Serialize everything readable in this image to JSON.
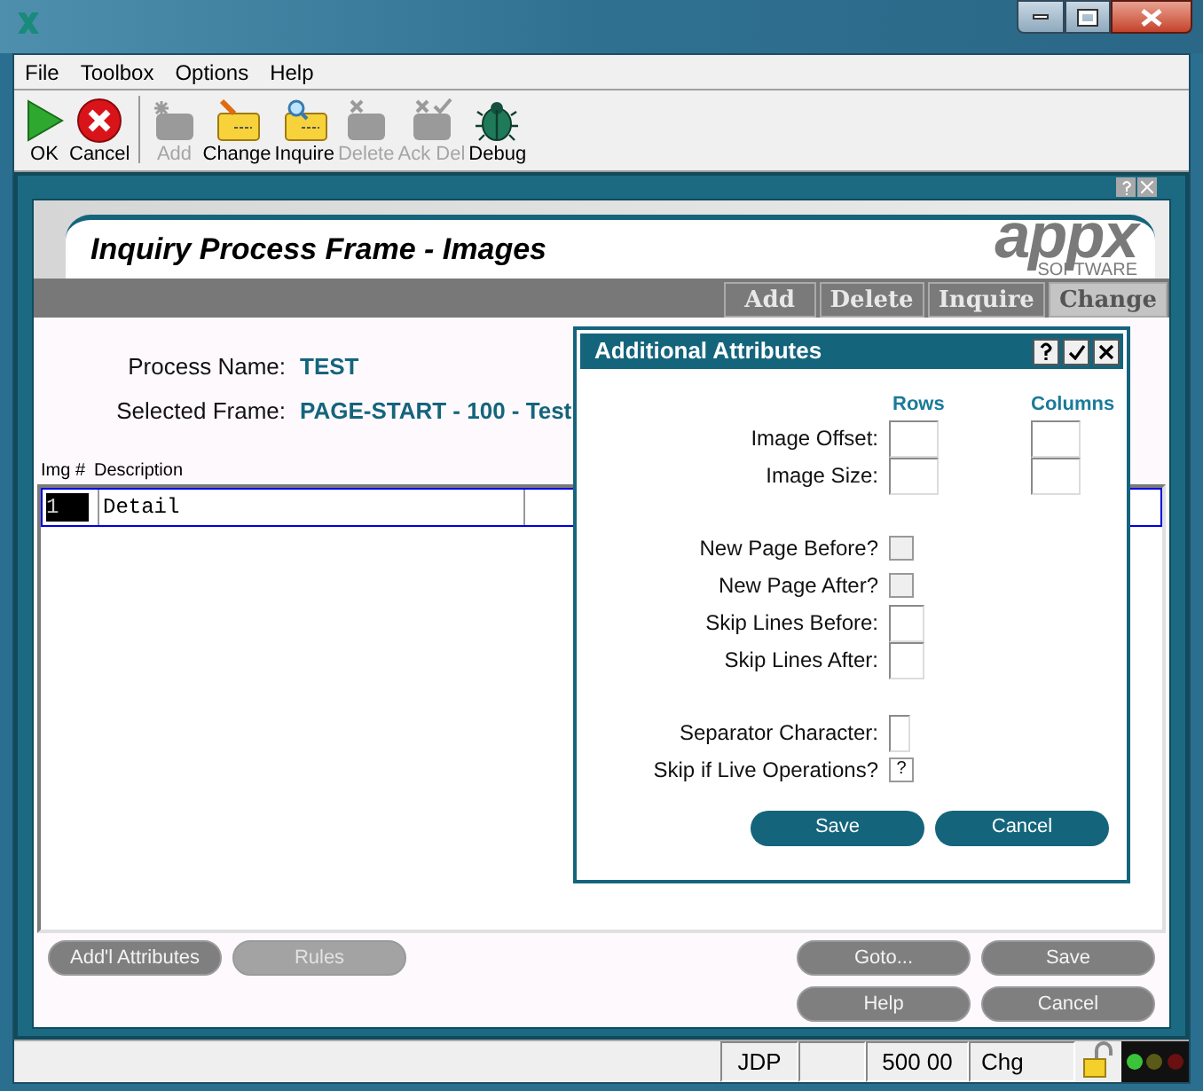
{
  "menu": [
    "File",
    "Toolbox",
    "Options",
    "Help"
  ],
  "toolbar": [
    {
      "label": "OK",
      "kind": "ok",
      "disabled": false
    },
    {
      "label": "Cancel",
      "kind": "cancel",
      "disabled": false
    },
    {
      "label": "Add",
      "kind": "add",
      "disabled": true
    },
    {
      "label": "Change",
      "kind": "change",
      "disabled": false
    },
    {
      "label": "Inquire",
      "kind": "inquire",
      "disabled": false
    },
    {
      "label": "Delete",
      "kind": "delete",
      "disabled": true
    },
    {
      "label": "Ack Del",
      "kind": "ackdel",
      "disabled": true
    },
    {
      "label": "Debug",
      "kind": "debug",
      "disabled": false
    }
  ],
  "frame": {
    "title": "Inquiry Process Frame - Images",
    "logo": {
      "word": "appx",
      "sub": "SOFTWARE"
    },
    "mode_tabs": [
      {
        "label": "Add",
        "selected": false
      },
      {
        "label": "Delete",
        "selected": false
      },
      {
        "label": "Inquire",
        "selected": false
      },
      {
        "label": "Change",
        "selected": true
      }
    ],
    "fields": [
      {
        "label": "Process Name:",
        "value": "TEST"
      },
      {
        "label": "Selected Frame:",
        "value": "PAGE-START - 100 - Test"
      }
    ],
    "table": {
      "columns": [
        "Img #",
        "Description"
      ],
      "rows": [
        {
          "img": "1",
          "description": "Detail",
          "selected": true
        }
      ]
    },
    "buttons_left": [
      {
        "label": "Add'l Attributes",
        "disabled": false
      },
      {
        "label": "Rules",
        "disabled": true
      }
    ],
    "buttons_right": [
      {
        "label": "Goto...",
        "disabled": false
      },
      {
        "label": "Save",
        "disabled": false
      },
      {
        "label": "Help",
        "disabled": false
      },
      {
        "label": "Cancel",
        "disabled": false
      }
    ]
  },
  "dialog": {
    "title": "Additional Attributes",
    "headers": [
      "Rows",
      "Columns"
    ],
    "rows": [
      {
        "kind": "pair",
        "label": "Image Offset:"
      },
      {
        "kind": "pair",
        "label": "Image Size:"
      },
      {
        "kind": "gap"
      },
      {
        "kind": "checkbox",
        "label": "New Page Before?",
        "disabled": true
      },
      {
        "kind": "checkbox",
        "label": "New Page After?",
        "disabled": true
      },
      {
        "kind": "field",
        "label": "Skip Lines Before:"
      },
      {
        "kind": "field",
        "label": "Skip Lines After:"
      },
      {
        "kind": "gap"
      },
      {
        "kind": "char",
        "label": "Separator Character:"
      },
      {
        "kind": "tristate",
        "label": "Skip if Live Operations?",
        "value": "?"
      }
    ],
    "buttons": [
      "Save",
      "Cancel"
    ]
  },
  "status_bar": [
    "JDP",
    "500 00",
    "Chg"
  ]
}
